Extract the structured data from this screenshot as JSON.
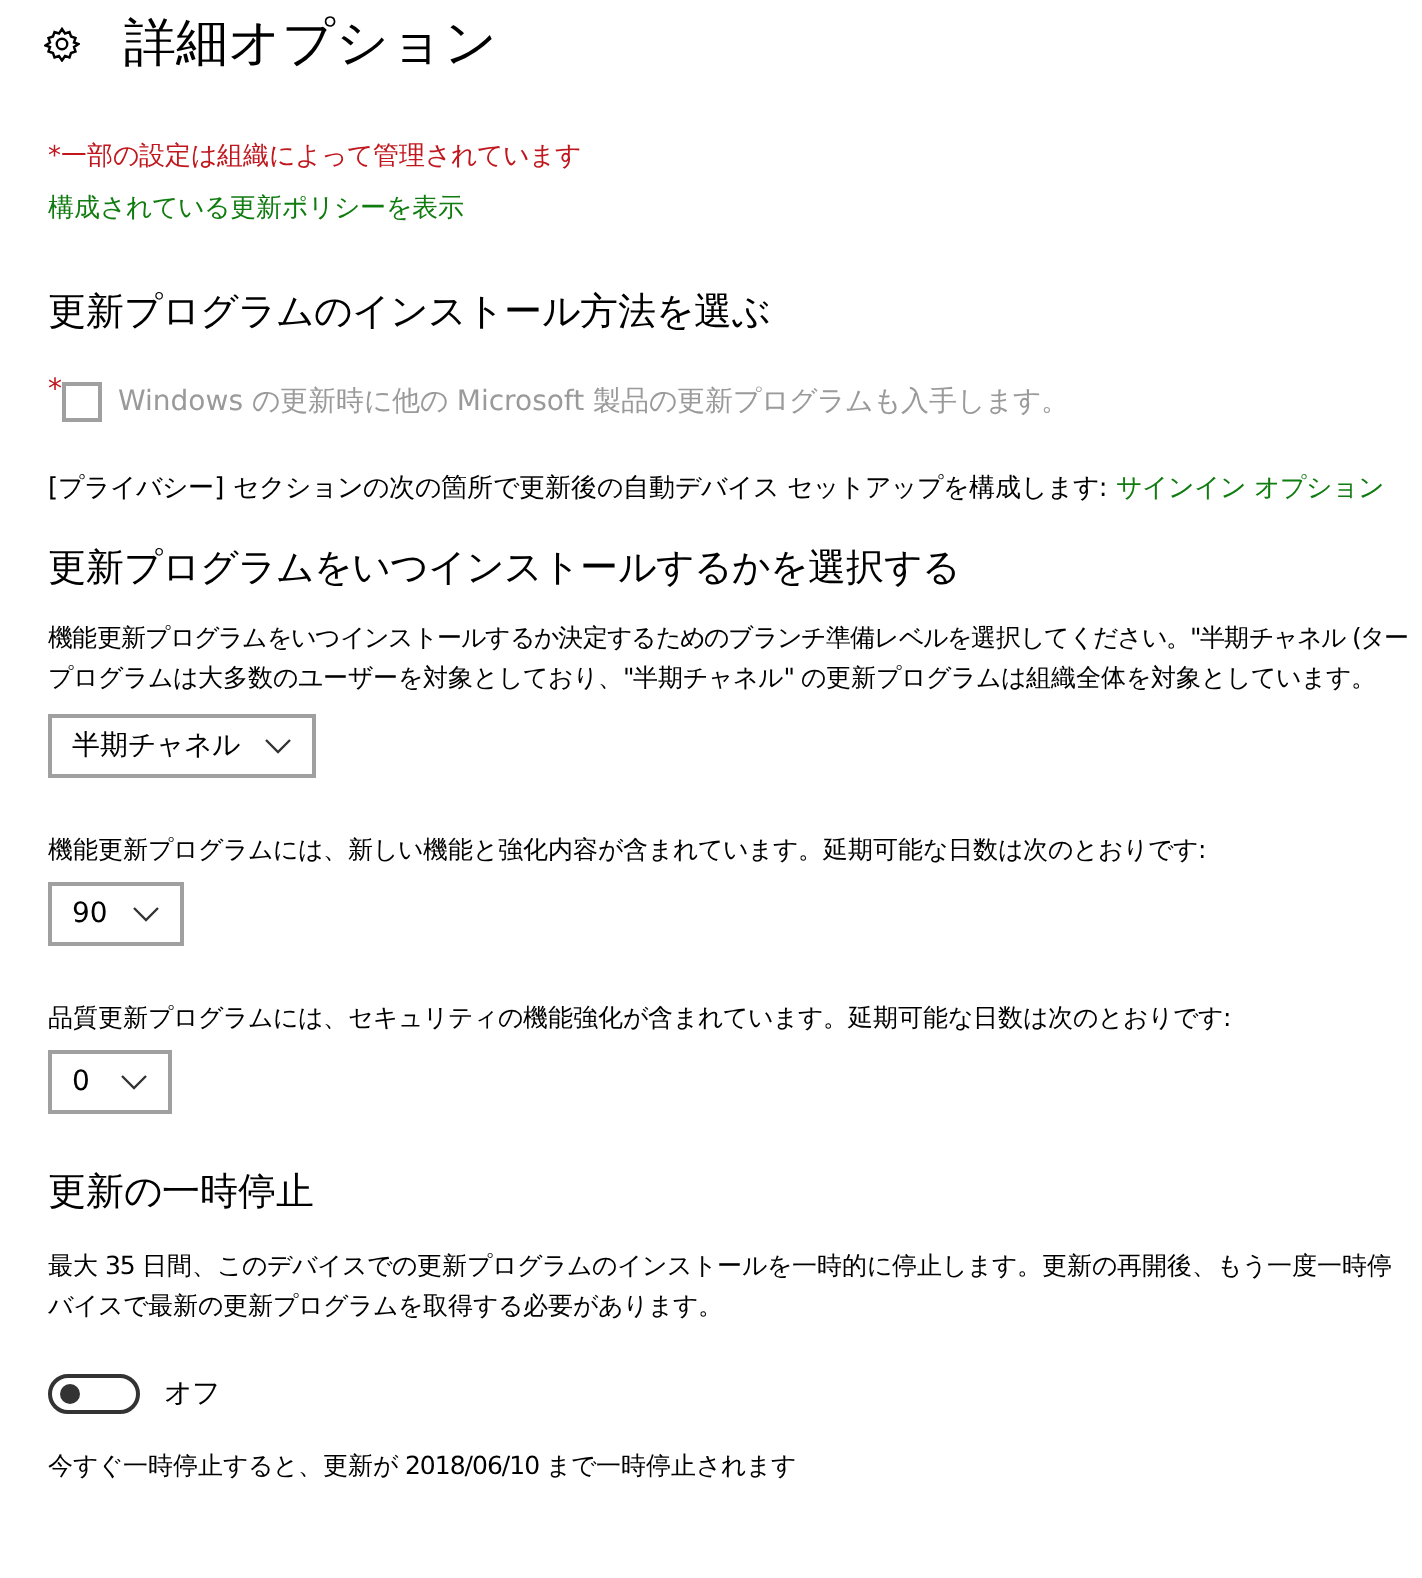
{
  "header": {
    "title": "詳細オプション"
  },
  "managed_notice": "*一部の設定は組織によって管理されています",
  "policy_link": "構成されている更新ポリシーを表示",
  "install_method": {
    "heading": "更新プログラムのインストール方法を選ぶ",
    "checkbox": {
      "required_mark": "*",
      "label": "Windows の更新時に他の Microsoft 製品の更新プログラムも入手します。",
      "checked": false,
      "disabled": true
    },
    "privacy_text": "[プライバシー] セクションの次の箇所で更新後の自動デバイス セットアップを構成します: ",
    "privacy_link": "サインイン オプション"
  },
  "schedule": {
    "heading": "更新プログラムをいつインストールするかを選択する",
    "description_lines": [
      "機能更新プログラムをいつインストールするか決定するためのブランチ準備レベルを選択してください。\"半期チャネル (ター",
      "プログラムは大多数のユーザーを対象としており、\"半期チャネル\" の更新プログラムは組織全体を対象としています。"
    ],
    "branch_dropdown": {
      "value": "半期チャネル"
    },
    "feature_text": "機能更新プログラムには、新しい機能と強化内容が含まれています。延期可能な日数は次のとおりです:",
    "feature_dropdown": {
      "value": "90"
    },
    "quality_text": "品質更新プログラムには、セキュリティの機能強化が含まれています。延期可能な日数は次のとおりです:",
    "quality_dropdown": {
      "value": "0"
    }
  },
  "pause": {
    "heading": "更新の一時停止",
    "description_lines": [
      "最大 35 日間、このデバイスでの更新プログラムのインストールを一時的に停止します。更新の再開後、もう一度一時停",
      "バイスで最新の更新プログラムを取得する必要があります。"
    ],
    "toggle": {
      "on": false,
      "label": "オフ"
    },
    "note": "今すぐ一時停止すると、更新が 2018/06/10 まで一時停止されます"
  }
}
